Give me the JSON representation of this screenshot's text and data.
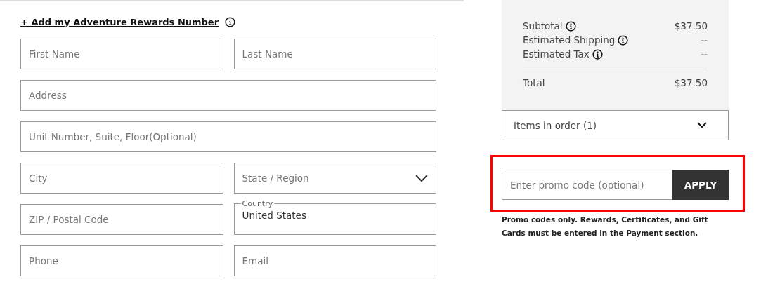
{
  "rewards_link": {
    "label": "+ Add my Adventure Rewards Number"
  },
  "form_rows": [
    [
      {
        "kind": "text",
        "placeholder": "First Name"
      },
      {
        "kind": "text",
        "placeholder": "Last Name"
      }
    ],
    [
      {
        "kind": "text",
        "placeholder": "Address"
      }
    ],
    [
      {
        "kind": "text",
        "placeholder": "Unit Number, Suite, Floor(Optional)"
      }
    ],
    [
      {
        "kind": "text",
        "placeholder": "City"
      },
      {
        "kind": "select",
        "placeholder": "State / Region"
      }
    ],
    [
      {
        "kind": "text",
        "placeholder": "ZIP / Postal Code"
      },
      {
        "kind": "labeled",
        "label": "Country",
        "value": "United States"
      }
    ],
    [
      {
        "kind": "text",
        "placeholder": "Phone"
      },
      {
        "kind": "text",
        "placeholder": "Email"
      }
    ]
  ],
  "summary": {
    "lines": [
      {
        "label": "Subtotal",
        "info": true,
        "value": "$37.50",
        "muted": false
      },
      {
        "label": "Estimated Shipping",
        "info": true,
        "value": "--",
        "muted": true
      },
      {
        "label": "Estimated Tax",
        "info": true,
        "value": "--",
        "muted": true
      }
    ],
    "total": {
      "label": "Total",
      "value": "$37.50"
    }
  },
  "items_in_order": {
    "label": "Items in order (1)",
    "expanded": false
  },
  "promo": {
    "highlighted": true,
    "placeholder": "Enter promo code (optional)",
    "button": "APPLY",
    "note": "Promo codes only. Rewards, Certificates, and Gift Cards must be entered in the Payment section."
  }
}
